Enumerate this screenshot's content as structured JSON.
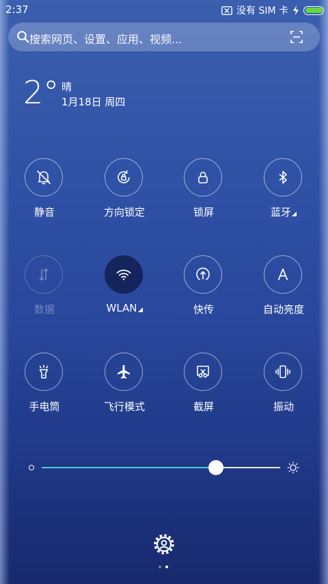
{
  "status_bar": {
    "time": "2:37",
    "sim_text": "没有 SIM 卡",
    "battery_level": 1.0
  },
  "search": {
    "placeholder": "搜索网页、设置、应用、视频..."
  },
  "weather": {
    "temperature": "2°",
    "condition": "晴",
    "date": "1月18日 周四"
  },
  "tiles": [
    {
      "label": "静音",
      "icon": "bell-off-icon",
      "state": "off",
      "has_arrow": false
    },
    {
      "label": "方向锁定",
      "icon": "rotation-lock-icon",
      "state": "off",
      "has_arrow": false
    },
    {
      "label": "锁屏",
      "icon": "lock-icon",
      "state": "off",
      "has_arrow": false
    },
    {
      "label": "蓝牙",
      "icon": "bluetooth-icon",
      "state": "off",
      "has_arrow": true
    },
    {
      "label": "数据",
      "icon": "mobile-data-icon",
      "state": "disabled",
      "has_arrow": false
    },
    {
      "label": "WLAN",
      "icon": "wifi-icon",
      "state": "on",
      "has_arrow": true
    },
    {
      "label": "快传",
      "icon": "quick-share-icon",
      "state": "off",
      "has_arrow": false
    },
    {
      "label": "自动亮度",
      "icon": "auto-brightness-icon",
      "state": "off",
      "has_arrow": false
    },
    {
      "label": "手电筒",
      "icon": "flashlight-icon",
      "state": "off",
      "has_arrow": false
    },
    {
      "label": "飞行模式",
      "icon": "airplane-icon",
      "state": "off",
      "has_arrow": false
    },
    {
      "label": "截屏",
      "icon": "screenshot-icon",
      "state": "off",
      "has_arrow": false
    },
    {
      "label": "振动",
      "icon": "vibrate-icon",
      "state": "off",
      "has_arrow": false
    }
  ],
  "brightness": {
    "level": 0.73,
    "accent_color": "#3ed6cc"
  },
  "pager": {
    "count": 2,
    "active": 1
  }
}
